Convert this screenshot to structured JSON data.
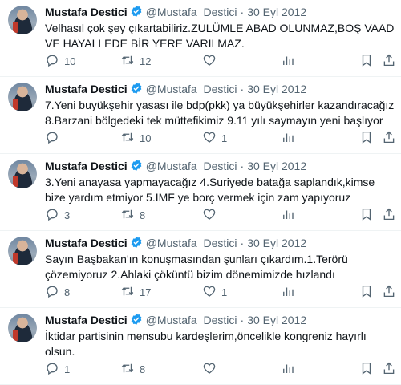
{
  "tweets": [
    {
      "name": "Mustafa Destici",
      "handle": "@Mustafa_Destici",
      "separator": "·",
      "date": "30 Eyl 2012",
      "text": "Velhasıl çok şey çıkartabiliriz.ZULÜMLE ABAD OLUNMAZ,BOŞ VAAD VE HAYALLEDE BİR YERE VARILMAZ.",
      "replies": "10",
      "retweets": "12",
      "likes": ""
    },
    {
      "name": "Mustafa Destici",
      "handle": "@Mustafa_Destici",
      "separator": "·",
      "date": "30 Eyl 2012",
      "text": "7.Yeni buyükşehir yasası ile bdp(pkk) ya büyükşehirler kazandıracağız 8.Barzani bölgedeki tek müttefikimiz 9.11 yılı saymayın yeni başlıyor",
      "replies": "",
      "retweets": "10",
      "likes": "1"
    },
    {
      "name": "Mustafa Destici",
      "handle": "@Mustafa_Destici",
      "separator": "·",
      "date": "30 Eyl 2012",
      "text": "3.Yeni anayasa yapmayacağız 4.Suriyede batağa saplandık,kimse bize yardım etmiyor 5.IMF ye borç vermek için zam yapıyoruz",
      "replies": "3",
      "retweets": "8",
      "likes": ""
    },
    {
      "name": "Mustafa Destici",
      "handle": "@Mustafa_Destici",
      "separator": "·",
      "date": "30 Eyl 2012",
      "text": "Sayın Başbakan'ın konuşmasından şunları çıkardım.1.Terörü çözemiyoruz 2.Ahlaki çöküntü bizim dönemimizde hızlandı",
      "replies": "8",
      "retweets": "17",
      "likes": "1"
    },
    {
      "name": "Mustafa Destici",
      "handle": "@Mustafa_Destici",
      "separator": "·",
      "date": "30 Eyl 2012",
      "text": "İktidar partisinin mensubu kardeşlerim,öncelikle kongreniz hayırlı olsun.",
      "replies": "1",
      "retweets": "8",
      "likes": ""
    }
  ],
  "icons": {
    "reply": "reply-icon",
    "retweet": "retweet-icon",
    "like": "heart-icon",
    "views": "views-icon",
    "bookmark": "bookmark-icon",
    "share": "share-icon",
    "verified": "verified-badge-icon"
  },
  "colors": {
    "verified": "#1d9bf0",
    "secondary_text": "#536471",
    "primary_text": "#0f1419",
    "divider": "#eff3f4"
  }
}
